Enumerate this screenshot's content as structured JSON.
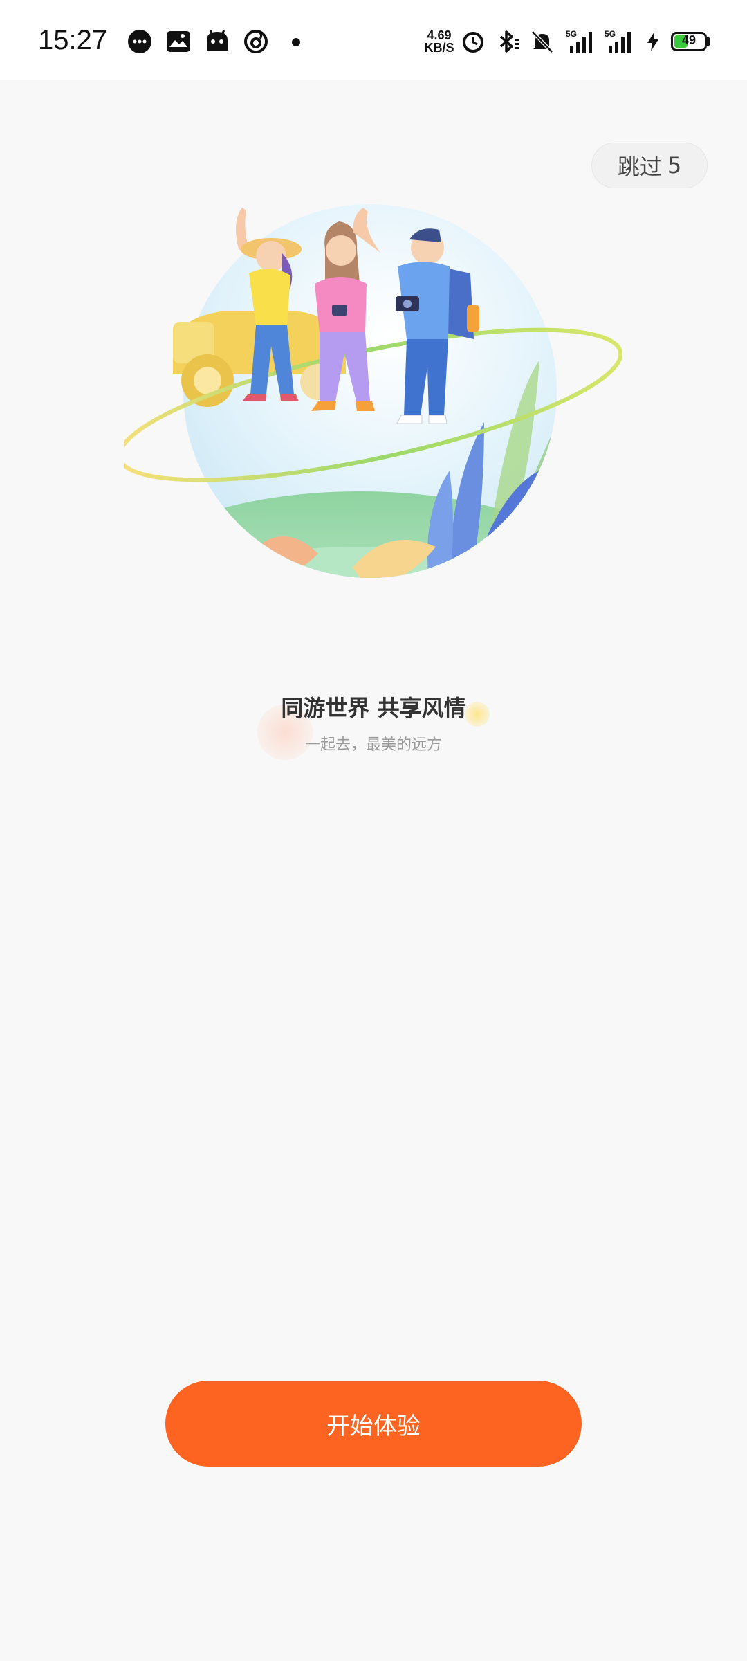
{
  "status_bar": {
    "time": "15:27",
    "notification_icons": [
      "chat-bubble-icon",
      "gallery-icon",
      "android-icon",
      "music-app-icon",
      "dot-icon"
    ],
    "network_speed_value": "4.69",
    "network_speed_unit": "KB/S",
    "signal_1_label": "5G",
    "signal_2_label": "5G",
    "battery_level": "49",
    "battery_color": "#39c93a"
  },
  "skip": {
    "label": "跳过",
    "countdown": "5"
  },
  "onboarding": {
    "headline": "同游世界 共享风情",
    "subline": "一起去，最美的远方"
  },
  "cta": {
    "label": "开始体验",
    "color": "#fd6421"
  }
}
